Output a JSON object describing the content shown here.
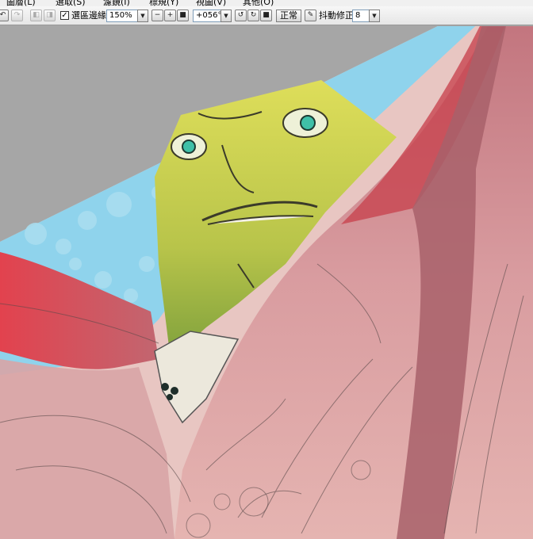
{
  "menu": {
    "items": [
      {
        "id": "layer",
        "label": "圖層(L)"
      },
      {
        "id": "select",
        "label": "選取(S)"
      },
      {
        "id": "filter",
        "label": "濾鏡(I)"
      },
      {
        "id": "ruler",
        "label": "標規(Y)"
      },
      {
        "id": "view",
        "label": "視圖(V)"
      },
      {
        "id": "other",
        "label": "其他(O)"
      }
    ]
  },
  "toolbar": {
    "selection_edge_label": "選區邊緣",
    "selection_edge_checked": true,
    "zoom_value": "150%",
    "rotation_value": "+056°",
    "normal_button_label": "正常",
    "stabilizer_label": "抖動修正",
    "stabilizer_value": "8"
  },
  "icons": {
    "undo": "undo-icon",
    "redo": "redo-icon",
    "zoom_out": "minus-icon",
    "zoom_in": "plus-icon",
    "zoom_reset": "square-icon",
    "rotate_left": "rotate-left-icon",
    "rotate_right": "rotate-right-icon",
    "rotate_reset": "square-icon",
    "dropdown": "chevron-down-icon"
  },
  "colors": {
    "toolbar_bg": "#eeeeee",
    "canvas_bg": "#a6a6a6",
    "sky_blue": "#88d2ee",
    "cloak_red": "#d85a60",
    "face_yellow": "#d8d852"
  }
}
